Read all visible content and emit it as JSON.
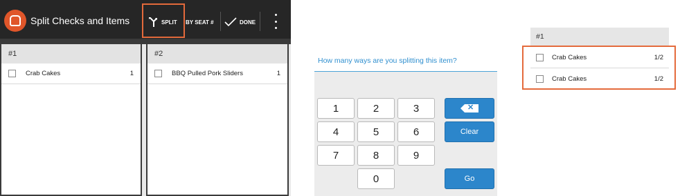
{
  "app": {
    "title": "Split Checks and Items",
    "toolbar": {
      "split_label": "SPLIT",
      "by_seat_label": "BY SEAT #",
      "done_label": "DONE"
    },
    "checks": [
      {
        "header": "#1",
        "items": [
          {
            "name": "Crab Cakes",
            "qty": "1"
          }
        ]
      },
      {
        "header": "#2",
        "items": [
          {
            "name": "BBQ Pulled Pork Sliders",
            "qty": "1"
          }
        ]
      }
    ]
  },
  "dialog": {
    "question": "How many ways are you splitting this item?",
    "keys": [
      "1",
      "2",
      "3",
      "4",
      "5",
      "6",
      "7",
      "8",
      "9",
      "0"
    ],
    "clear_label": "Clear",
    "go_label": "Go"
  },
  "result": {
    "header": "#1",
    "items": [
      {
        "name": "Crab Cakes",
        "fraction": "1/2"
      },
      {
        "name": "Crab Cakes",
        "fraction": "1/2"
      }
    ]
  },
  "colors": {
    "accent_orange": "#e46a3b",
    "button_blue": "#2c86cb",
    "question_blue": "#2f8fcf",
    "toolbar_dark": "#262626"
  }
}
